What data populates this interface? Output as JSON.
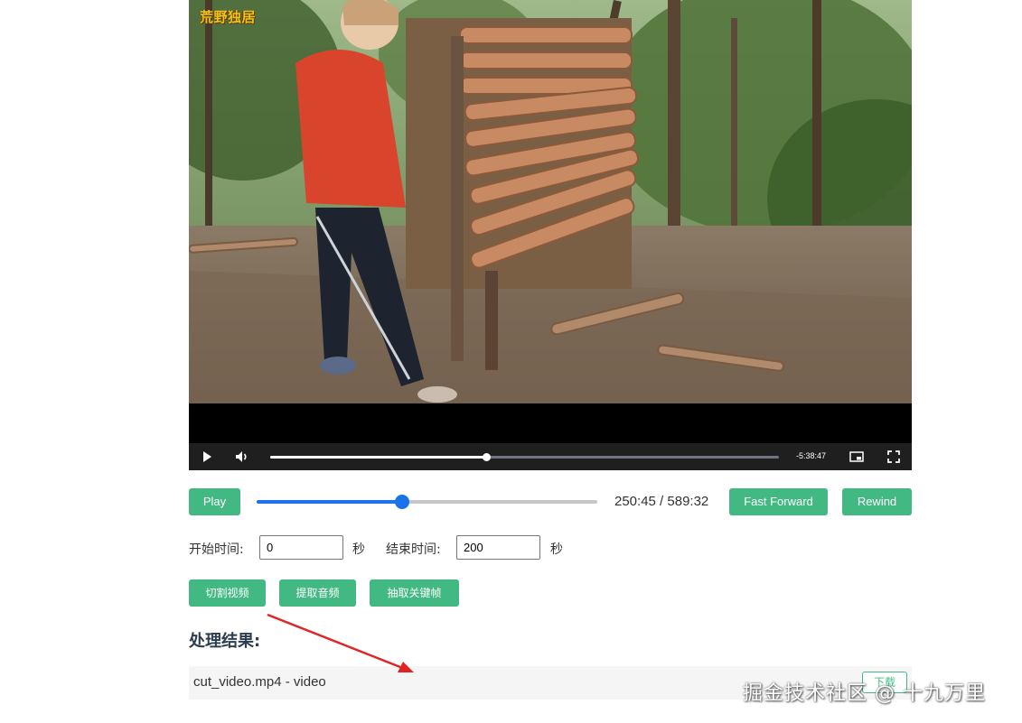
{
  "video": {
    "channel_logo": "荒野独居",
    "remaining_time": "-5:38:47",
    "progress_fraction": 0.425,
    "icons": {
      "play": "play-icon",
      "volume": "volume-icon",
      "pip": "picture-in-picture-icon",
      "fullscreen": "fullscreen-icon"
    }
  },
  "toolbar": {
    "play_label": "Play",
    "seek_fraction": 0.428,
    "time_readout": "250:45 / 589:32",
    "fast_forward_label": "Fast Forward",
    "rewind_label": "Rewind"
  },
  "range": {
    "start_label": "开始时间:",
    "start_value": "0",
    "start_unit": "秒",
    "end_label": "结束时间:",
    "end_value": "200",
    "end_unit": "秒"
  },
  "actions": {
    "cut_label": "切割视频",
    "audio_label": "提取音频",
    "keyframe_label": "抽取关键帧"
  },
  "results": {
    "title": "处理结果:",
    "items": [
      {
        "text": "cut_video.mp4 - video",
        "download_label": "下载"
      }
    ]
  },
  "watermark": "掘金技术社区 @ 十九万里",
  "colors": {
    "accent_green": "#42b983",
    "slider_blue": "#1a73e8",
    "annotation_red": "#e02424"
  }
}
